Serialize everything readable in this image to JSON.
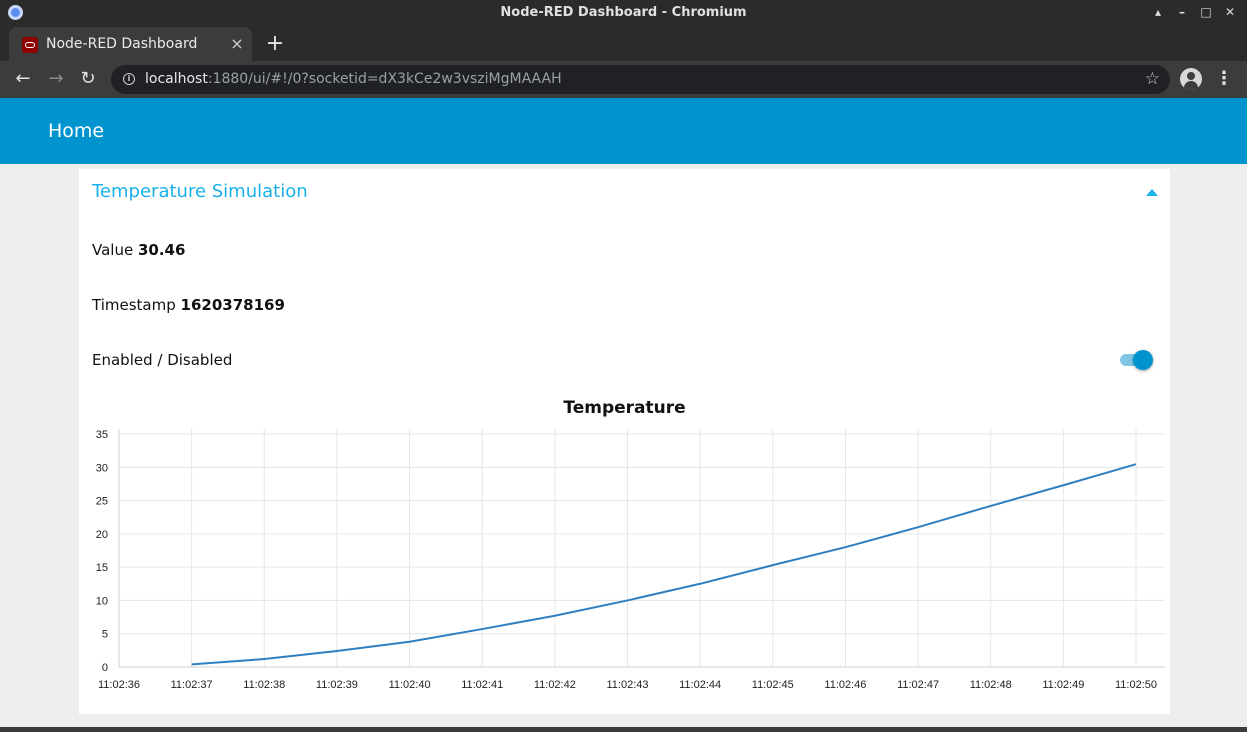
{
  "window": {
    "title": "Node-RED Dashboard - Chromium",
    "controls": [
      "minimize-up",
      "minimize",
      "maximize",
      "close"
    ]
  },
  "browser": {
    "tab_title": "Node-RED Dashboard",
    "tab_close": "×",
    "new_tab": "+",
    "url_host": "localhost",
    "url_rest": ":1880/ui/#!/0?socketid=dX3kCe2w3vsziMgMAAAH",
    "icons": {
      "back": "back-arrow-icon",
      "forward": "forward-arrow-icon",
      "reload": "reload-icon",
      "info": "info-icon",
      "bookmark": "star-icon",
      "profile": "profile-icon",
      "menu": "kebab-menu-icon"
    }
  },
  "dashboard": {
    "header_title": "Home",
    "header_color": "#0094ce",
    "accent_color": "#1bb1e9",
    "group_title": "Temperature Simulation",
    "value_label": "Value",
    "value": "30.46",
    "timestamp_label": "Timestamp",
    "timestamp": "1620378169",
    "toggle_label": "Enabled / Disabled",
    "toggle_state": "on"
  },
  "chart_data": {
    "type": "line",
    "title": "Temperature",
    "xlabel": "",
    "ylabel": "",
    "x_ticks": [
      "11:02:36",
      "11:02:37",
      "11:02:38",
      "11:02:39",
      "11:02:40",
      "11:02:41",
      "11:02:42",
      "11:02:43",
      "11:02:44",
      "11:02:45",
      "11:02:46",
      "11:02:47",
      "11:02:48",
      "11:02:49",
      "11:02:50"
    ],
    "y_ticks": [
      0,
      5,
      10,
      15,
      20,
      25,
      30,
      35
    ],
    "ylim": [
      0,
      35
    ],
    "grid": true,
    "line_color": "#2f7fc1",
    "series": [
      {
        "x": [
          "11:02:37",
          "11:02:38",
          "11:02:39",
          "11:02:40",
          "11:02:41",
          "11:02:42",
          "11:02:43",
          "11:02:44",
          "11:02:45",
          "11:02:46",
          "11:02:47",
          "11:02:48",
          "11:02:49",
          "11:02:50"
        ],
        "values": [
          0.4,
          1.2,
          2.4,
          3.8,
          5.7,
          7.7,
          10.0,
          12.5,
          15.3,
          18.0,
          21.0,
          24.2,
          27.3,
          30.46
        ]
      }
    ]
  }
}
